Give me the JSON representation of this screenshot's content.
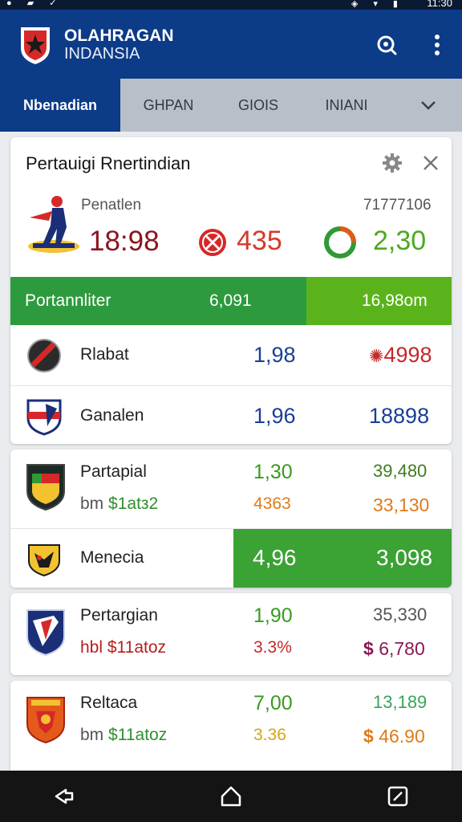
{
  "status_bar": {
    "time": "11:30",
    "left_icons": "● ▰ ✓",
    "right_icons": "◈ ▾ ▮"
  },
  "app": {
    "title_line1": "OLAHRAGAN",
    "title_line2": "INDANSIA"
  },
  "tabs": [
    {
      "label": "Nbenadian",
      "active": true
    },
    {
      "label": "GHPAN",
      "active": false
    },
    {
      "label": "GIOIS",
      "active": false
    },
    {
      "label": "INIANI",
      "active": false
    }
  ],
  "card1": {
    "title": "Pertauigi Rnertindian",
    "sub_label": "Penatlen",
    "sub_id": "71777106",
    "score_main": "18:98",
    "score_mid": "435",
    "score_right": "2,30",
    "highlight": {
      "label": "Portannliter",
      "mid": "6,091",
      "right": "16,98om"
    },
    "rows": [
      {
        "name": "Rlabat",
        "v1": "1,98",
        "v2": "4998"
      },
      {
        "name": "Ganalen",
        "v1": "1,96",
        "v2": "18898"
      }
    ]
  },
  "card2": {
    "name": "Partapial",
    "sub_prefix": "bm",
    "sub_amount": "$1atз2",
    "v1": "1,30",
    "v2": "4363",
    "v3": "39,480",
    "v4": "33,130",
    "sub_row": {
      "name": "Menecia",
      "v1": "4,96",
      "v2": "3,098"
    }
  },
  "card3": {
    "name": "Pertargian",
    "sub_prefix": "hbl",
    "sub_amount": "$11atoz",
    "v1": "1,90",
    "v2": "3.3%",
    "v3": "35,330",
    "v4_sym": "$",
    "v4": "6,780"
  },
  "card4": {
    "name": "Reltaca",
    "sub_prefix": "bm",
    "sub_amount": "$11atoz",
    "v1": "7,00",
    "v2": "3.36",
    "v3": "13,189",
    "v4_sym": "$",
    "v4": "46.90"
  },
  "colors": {
    "primary": "#0c3b87",
    "accent_green": "#2d9a3e",
    "accent_lime": "#5bb31c",
    "score_red": "#8b1420"
  }
}
